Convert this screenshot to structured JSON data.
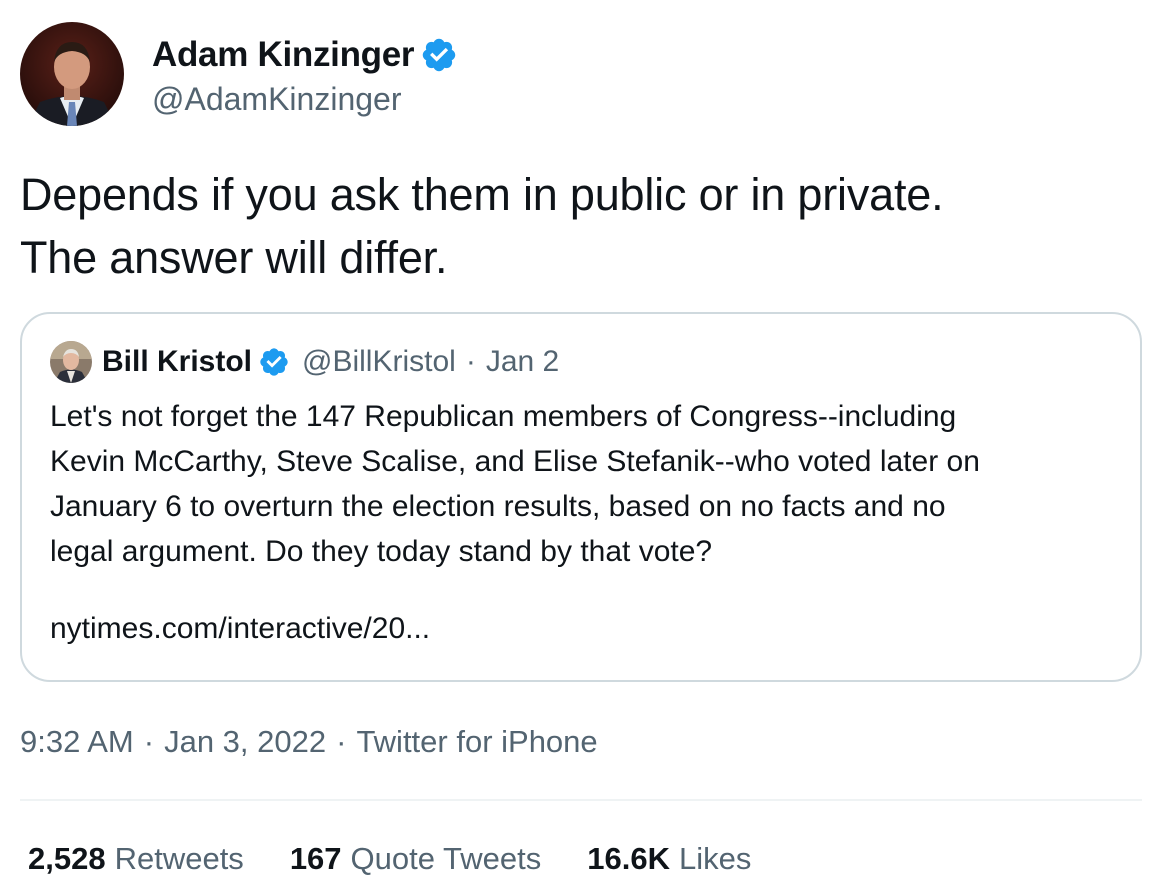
{
  "author": {
    "name": "Adam Kinzinger",
    "handle": "@AdamKinzinger",
    "verified": true,
    "avatar": "profile-photo-man-suit"
  },
  "tweet": {
    "lines": [
      "Depends if you ask them in public or in private.",
      "The answer will differ."
    ]
  },
  "quoted_tweet": {
    "name": "Bill Kristol",
    "handle": "@BillKristol",
    "separator": "·",
    "date": "Jan 2",
    "verified": true,
    "avatar": "profile-photo-older-man",
    "body_lines": [
      "Let's not forget the 147 Republican members of Congress--including",
      "Kevin McCarthy, Steve Scalise, and Elise Stefanik--who voted later on",
      "January 6 to overturn the election results, based on no facts and no",
      "legal argument. Do they today stand by that vote?"
    ],
    "link": "nytimes.com/interactive/20..."
  },
  "meta": {
    "time": "9:32 AM",
    "date": "Jan 3, 2022",
    "source": "Twitter for iPhone",
    "separator": "·"
  },
  "stats": [
    {
      "count": "2,528",
      "label": "Retweets"
    },
    {
      "count": "167",
      "label": "Quote Tweets"
    },
    {
      "count": "16.6K",
      "label": "Likes"
    }
  ],
  "colors": {
    "verified_blue": "#1d9bf0",
    "text_primary": "#0f1419",
    "text_secondary": "#536471",
    "border": "#cfd9de"
  }
}
